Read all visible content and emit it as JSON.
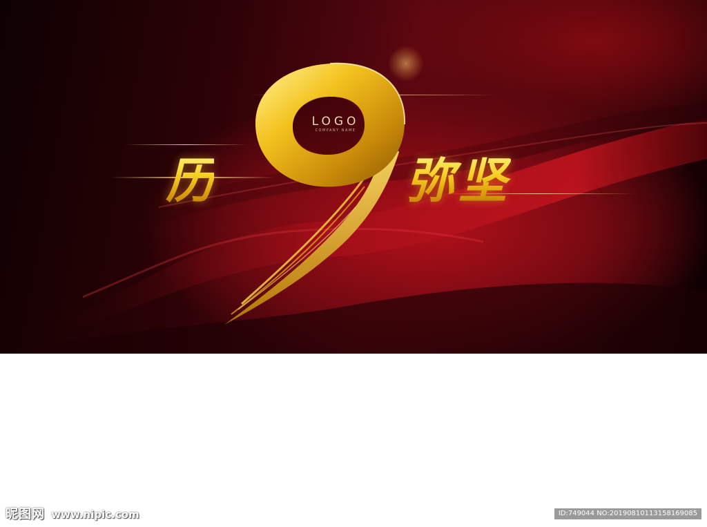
{
  "banner": {
    "logo_text": "LOGO",
    "company_text": "COMPANY NAME",
    "headline_left": "历",
    "headline_number": "9",
    "headline_right": "弥坚"
  },
  "watermark": {
    "site_name": "昵图网",
    "site_url": "www.nipic.com",
    "image_id": "ID:749044 NO:20190810113158169085"
  },
  "colors": {
    "background_dark": "#1a0204",
    "background_red": "#9b0c14",
    "gold": "#f3c91f",
    "gold_dark": "#b97606",
    "page_white": "#ffffff"
  }
}
